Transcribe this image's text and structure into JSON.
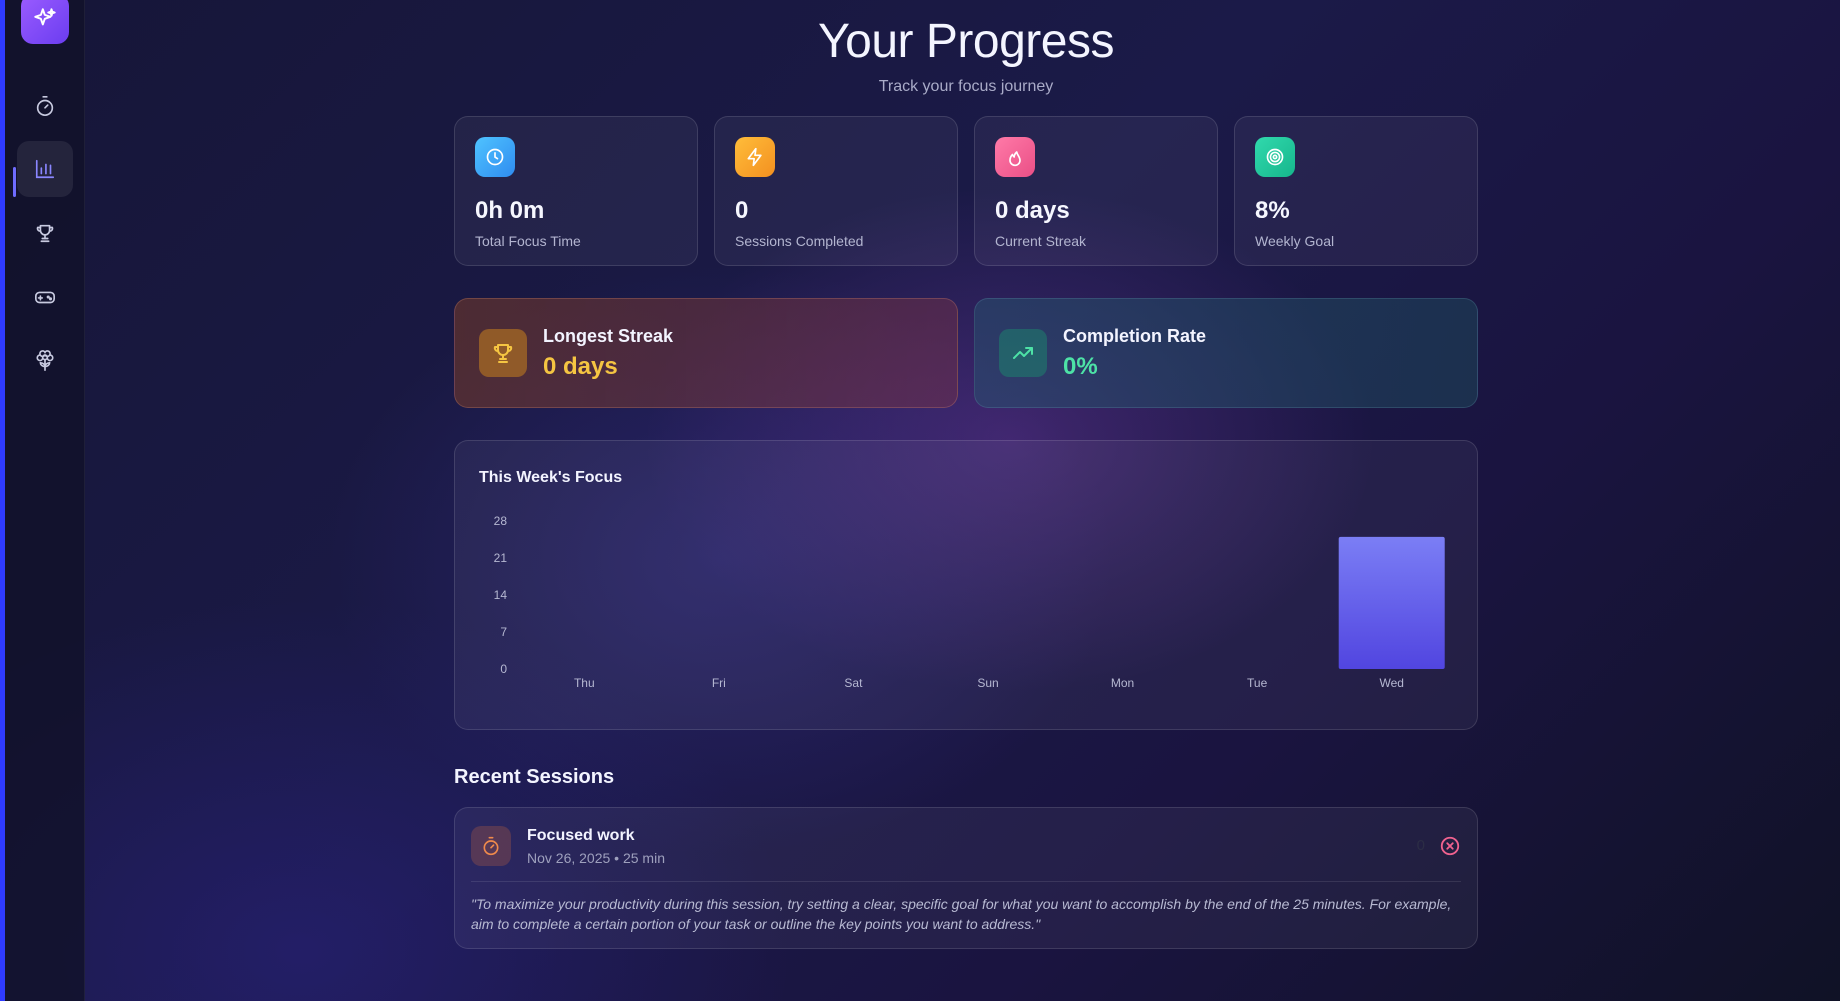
{
  "sidebar": {
    "logo_icon": "sparkles-icon",
    "items": [
      {
        "id": "timer",
        "icon": "stopwatch-icon",
        "active": false
      },
      {
        "id": "stats",
        "icon": "bar-chart-icon",
        "active": true
      },
      {
        "id": "achievements",
        "icon": "trophy-icon",
        "active": false
      },
      {
        "id": "games",
        "icon": "gamepad-icon",
        "active": false
      },
      {
        "id": "garden",
        "icon": "flower-icon",
        "active": false
      }
    ],
    "accent": "#6f6cff"
  },
  "header": {
    "title": "Your Progress",
    "subtitle": "Track your focus journey"
  },
  "stats": [
    {
      "icon": "clock-icon",
      "color": "#3fb6f5",
      "value": "0h 0m",
      "label": "Total Focus Time"
    },
    {
      "icon": "lightning-icon",
      "color": "#f7a531",
      "value": "0",
      "label": "Sessions Completed"
    },
    {
      "icon": "flame-icon",
      "color": "#f06a9a",
      "value": "0 days",
      "label": "Current Streak"
    },
    {
      "icon": "target-icon",
      "color": "#27c9a0",
      "value": "8%",
      "label": "Weekly Goal"
    }
  ],
  "highlights": {
    "streak": {
      "icon": "trophy-icon",
      "title": "Longest Streak",
      "value": "0 days",
      "color": "#f5c542"
    },
    "rate": {
      "icon": "trending-up-icon",
      "title": "Completion Rate",
      "value": "0%",
      "color": "#4de2a6"
    }
  },
  "chart_data": {
    "type": "bar",
    "title": "This Week's Focus",
    "categories": [
      "Thu",
      "Fri",
      "Sat",
      "Sun",
      "Mon",
      "Tue",
      "Wed"
    ],
    "values": [
      0,
      0,
      0,
      0,
      0,
      0,
      25
    ],
    "yticks": [
      0,
      7,
      14,
      21,
      28
    ],
    "ylim": [
      0,
      28
    ],
    "xlabel": "",
    "ylabel": "",
    "grid": false,
    "bar_color_top": "#7b7ef5",
    "bar_color_bottom": "#5145e0"
  },
  "recent": {
    "title": "Recent Sessions",
    "sessions": [
      {
        "icon": "stopwatch-icon",
        "name": "Focused work",
        "meta": "Nov 26, 2025 • 25 min",
        "count": "0",
        "quote": "\"To maximize your productivity during this session, try setting a clear, specific goal for what you want to accomplish by the end of the 25 minutes. For example, aim to complete a certain portion of your task or outline the key points you want to address.\""
      }
    ]
  }
}
